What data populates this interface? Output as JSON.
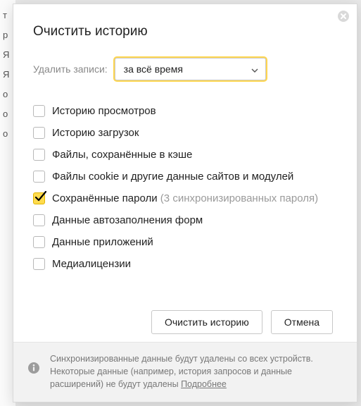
{
  "bg_letters": "т р Я Я о о о",
  "dialog": {
    "title": "Очистить историю",
    "range_label": "Удалить записи:",
    "range_select": {
      "value": "за всё время"
    },
    "options": [
      {
        "key": "history",
        "label": "Историю просмотров",
        "checked": false
      },
      {
        "key": "downloads",
        "label": "Историю загрузок",
        "checked": false
      },
      {
        "key": "cache",
        "label": "Файлы, сохранённые в кэше",
        "checked": false
      },
      {
        "key": "cookies",
        "label": "Файлы cookie и другие данные сайтов и модулей",
        "checked": false
      },
      {
        "key": "passwords",
        "label": "Сохранённые пароли",
        "suffix": "(3 синхронизированных пароля)",
        "checked": true
      },
      {
        "key": "autofill",
        "label": "Данные автозаполнения форм",
        "checked": false
      },
      {
        "key": "apps",
        "label": "Данные приложений",
        "checked": false
      },
      {
        "key": "media",
        "label": "Медиалицензии",
        "checked": false
      }
    ],
    "buttons": {
      "clear": "Очистить историю",
      "cancel": "Отмена"
    },
    "info": {
      "text": "Синхронизированные данные будут удалены со всех устройств. Некоторые данные (например, история запросов и данные расширений) не будут удалены ",
      "link": "Подробнее"
    }
  }
}
